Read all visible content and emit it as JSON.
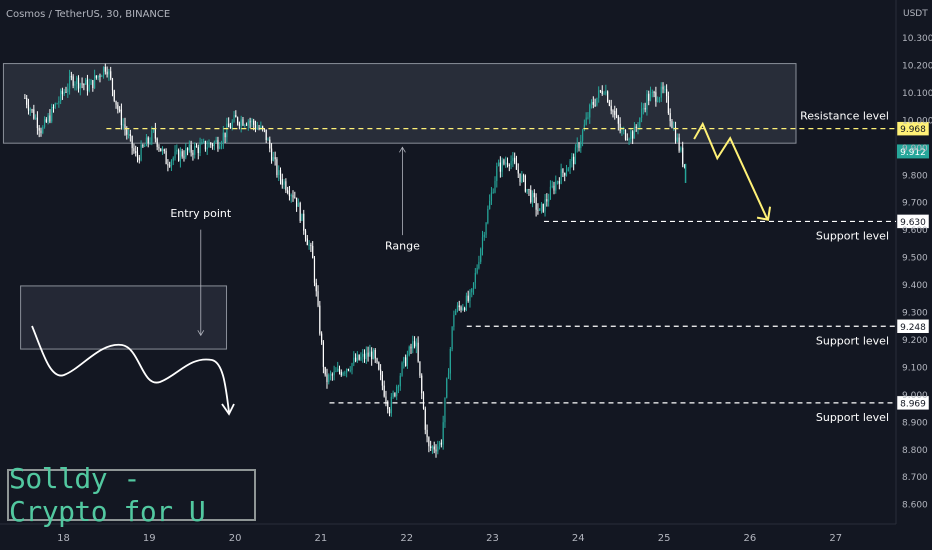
{
  "header": {
    "title": "Cosmos / TetherUS, 30, BINANCE",
    "currency": "USDT"
  },
  "brand": {
    "text": "Solldy - Crypto for U"
  },
  "colors": {
    "background": "#131722",
    "up": "#26a69a",
    "down": "#ffffff",
    "annotation": "#fff176",
    "line_dashed": "#ffffff",
    "zone_fill": "#2a2e39"
  },
  "chart_data": {
    "type": "candlestick",
    "symbol": "Cosmos / TetherUS",
    "timeframe": "30",
    "exchange": "BINANCE",
    "x_tick_labels": [
      "18",
      "19",
      "20",
      "21",
      "22",
      "23",
      "24",
      "25",
      "26",
      "27"
    ],
    "y_tick_labels": [
      "10.300",
      "10.200",
      "10.100",
      "10.000",
      "9.900",
      "9.800",
      "9.700",
      "9.600",
      "9.500",
      "9.400",
      "9.300",
      "9.200",
      "9.100",
      "9.000",
      "8.900",
      "8.800",
      "8.700",
      "8.600"
    ],
    "ylim": [
      8.6,
      10.35
    ],
    "price_path": [
      {
        "day": 17.55,
        "price": 10.08
      },
      {
        "day": 17.75,
        "price": 9.96
      },
      {
        "day": 17.9,
        "price": 10.05
      },
      {
        "day": 18.1,
        "price": 10.15
      },
      {
        "day": 18.3,
        "price": 10.12
      },
      {
        "day": 18.5,
        "price": 10.2
      },
      {
        "day": 18.65,
        "price": 10.02
      },
      {
        "day": 18.85,
        "price": 9.86
      },
      {
        "day": 19.05,
        "price": 9.95
      },
      {
        "day": 19.2,
        "price": 9.85
      },
      {
        "day": 19.4,
        "price": 9.88
      },
      {
        "day": 19.6,
        "price": 9.9
      },
      {
        "day": 19.8,
        "price": 9.92
      },
      {
        "day": 20.0,
        "price": 10.0
      },
      {
        "day": 20.15,
        "price": 10.0
      },
      {
        "day": 20.35,
        "price": 9.95
      },
      {
        "day": 20.5,
        "price": 9.8
      },
      {
        "day": 20.7,
        "price": 9.72
      },
      {
        "day": 20.9,
        "price": 9.5
      },
      {
        "day": 21.05,
        "price": 9.05
      },
      {
        "day": 21.2,
        "price": 9.08
      },
      {
        "day": 21.4,
        "price": 9.12
      },
      {
        "day": 21.6,
        "price": 9.15
      },
      {
        "day": 21.8,
        "price": 8.95
      },
      {
        "day": 21.95,
        "price": 9.1
      },
      {
        "day": 22.1,
        "price": 9.2
      },
      {
        "day": 22.25,
        "price": 8.8
      },
      {
        "day": 22.4,
        "price": 8.82
      },
      {
        "day": 22.55,
        "price": 9.3
      },
      {
        "day": 22.75,
        "price": 9.35
      },
      {
        "day": 22.9,
        "price": 9.6
      },
      {
        "day": 23.05,
        "price": 9.82
      },
      {
        "day": 23.2,
        "price": 9.86
      },
      {
        "day": 23.35,
        "price": 9.78
      },
      {
        "day": 23.55,
        "price": 9.66
      },
      {
        "day": 23.75,
        "price": 9.78
      },
      {
        "day": 23.95,
        "price": 9.86
      },
      {
        "day": 24.15,
        "price": 10.05
      },
      {
        "day": 24.3,
        "price": 10.12
      },
      {
        "day": 24.5,
        "price": 9.95
      },
      {
        "day": 24.65,
        "price": 9.95
      },
      {
        "day": 24.8,
        "price": 10.08
      },
      {
        "day": 25.0,
        "price": 10.1
      },
      {
        "day": 25.1,
        "price": 9.98
      },
      {
        "day": 25.25,
        "price": 9.82
      }
    ],
    "last_candle": {
      "day": 25.25,
      "high": 9.84,
      "low": 9.77
    },
    "zones": [
      {
        "name": "resistance-zone",
        "day_from": 17.3,
        "day_to": 26.7,
        "price_low": 9.915,
        "price_high": 10.205
      },
      {
        "name": "entry-zone",
        "day_from": 17.5,
        "day_to": 19.9,
        "price_low": 9.165,
        "price_high": 9.395
      }
    ],
    "levels": [
      {
        "price": 9.968,
        "label": "Resistance level",
        "tag": "9.968",
        "day_from": 18.5
      },
      {
        "price": 9.63,
        "label": "Support level",
        "tag": "9.630",
        "day_from": 23.6
      },
      {
        "price": 9.248,
        "label": "Support level",
        "tag": "9.248",
        "day_from": 22.7
      },
      {
        "price": 8.969,
        "label": "Support level",
        "tag": "8.969",
        "day_from": 21.1
      }
    ],
    "current_price_tag": "9.912",
    "annotations": [
      {
        "label": "Entry point",
        "day": 19.6,
        "price": 9.66
      },
      {
        "label": "Range",
        "day": 21.95,
        "price": 9.55
      }
    ]
  }
}
